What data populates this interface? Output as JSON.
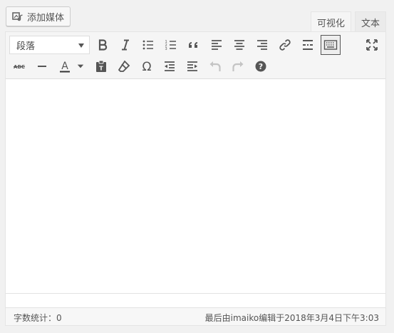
{
  "media": {
    "add_label": "添加媒体"
  },
  "tabs": {
    "visual": "可视化",
    "text": "文本"
  },
  "toolbar": {
    "format_select": "段落",
    "row1": [
      {
        "name": "bold-button",
        "icon": "bold-icon"
      },
      {
        "name": "italic-button",
        "icon": "italic-icon"
      },
      {
        "name": "bullet-list-button",
        "icon": "bullet-list-icon"
      },
      {
        "name": "numbered-list-button",
        "icon": "numbered-list-icon"
      },
      {
        "name": "blockquote-button",
        "icon": "quote-icon"
      },
      {
        "name": "align-left-button",
        "icon": "align-left-icon"
      },
      {
        "name": "align-center-button",
        "icon": "align-center-icon"
      },
      {
        "name": "align-right-button",
        "icon": "align-right-icon"
      },
      {
        "name": "insert-link-button",
        "icon": "link-icon"
      },
      {
        "name": "read-more-button",
        "icon": "read-more-icon"
      },
      {
        "name": "toolbar-toggle-button",
        "icon": "keyboard-icon"
      },
      {
        "name": "fullscreen-button",
        "icon": "fullscreen-icon"
      }
    ],
    "row2": [
      {
        "name": "strikethrough-button",
        "icon": "strikethrough-icon"
      },
      {
        "name": "horizontal-line-button",
        "icon": "horizontal-line-icon"
      },
      {
        "name": "text-color-button",
        "icon": "text-color-icon",
        "label": "A"
      },
      {
        "name": "paste-text-button",
        "icon": "paste-icon"
      },
      {
        "name": "clear-formatting-button",
        "icon": "eraser-icon"
      },
      {
        "name": "special-character-button",
        "icon": "omega-icon",
        "label": "Ω"
      },
      {
        "name": "outdent-button",
        "icon": "outdent-icon"
      },
      {
        "name": "indent-button",
        "icon": "indent-icon"
      },
      {
        "name": "undo-button",
        "icon": "undo-icon"
      },
      {
        "name": "redo-button",
        "icon": "redo-icon"
      },
      {
        "name": "help-button",
        "icon": "help-icon",
        "label": "?"
      }
    ],
    "strike_label": "ABC"
  },
  "status": {
    "word_count": "字数统计：0",
    "last_edited": "最后由imaiko编辑于2018年3月4日下午3:03"
  },
  "colors": {
    "text_color_bar": "#333333",
    "active_border": "#555555"
  }
}
